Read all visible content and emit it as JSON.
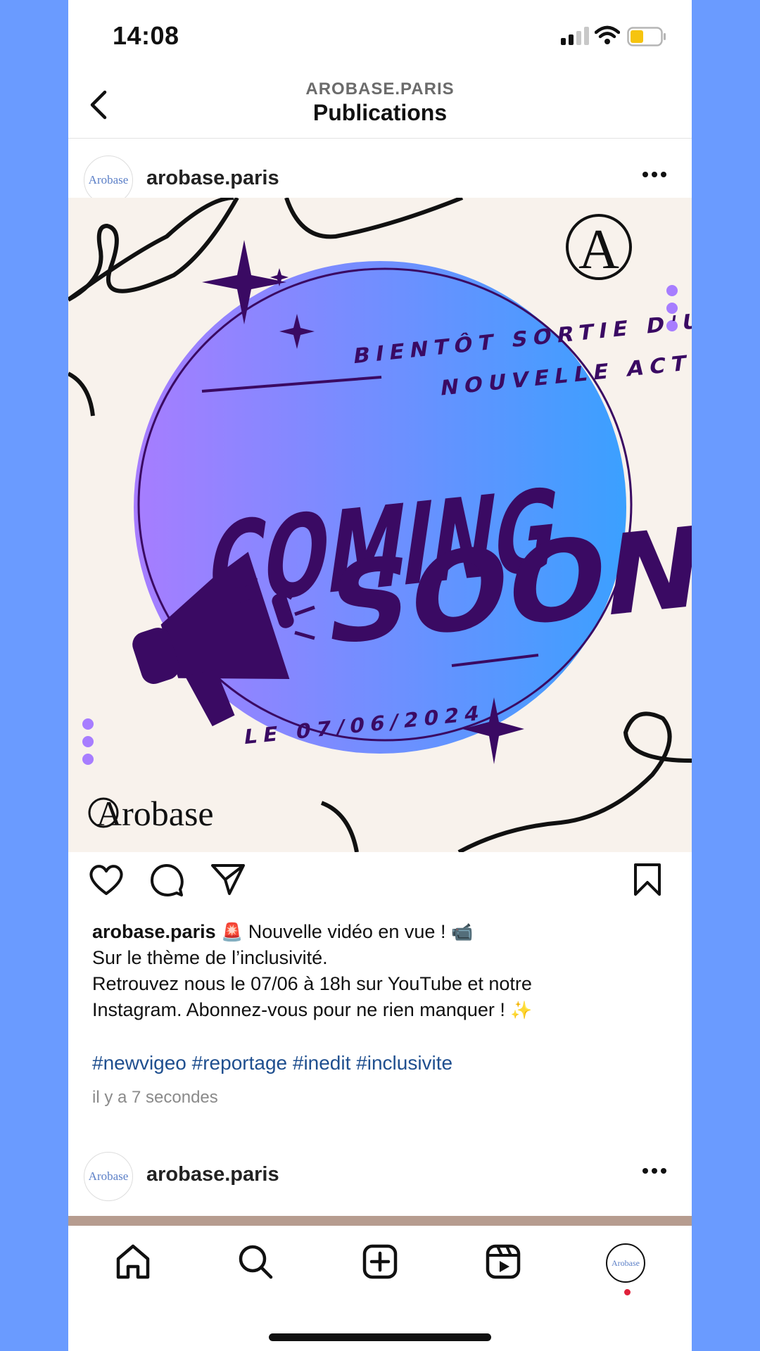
{
  "status": {
    "time": "14:08"
  },
  "header": {
    "account": "AROBASE.PARIS",
    "title": "Publications"
  },
  "post": {
    "username": "arobase.paris",
    "avatar_text": "Arobase",
    "image": {
      "headline_top": "BIENTÔT SORTIE D'UNE",
      "headline_bottom": "NOUVELLE ACTU.",
      "big_line1": "COMING",
      "big_line2": "SOON",
      "date": "LE 07/06/2024",
      "brand": "Arobase",
      "brand_letter": "A"
    },
    "caption": {
      "username": "arobase.paris",
      "emoji_siren": "🚨",
      "line1": "Nouvelle vidéo en vue !",
      "emoji_camera": "📹",
      "line2": "Sur le thème de l’inclusivité.",
      "line3": "Retrouvez nous le 07/06 à 18h sur YouTube et notre",
      "line4": "Instagram. Abonnez-vous pour ne rien manquer !",
      "emoji_sparkles": "✨"
    },
    "hashtags": "#newvigeo #reportage #inedit #inclusivite",
    "time_ago": "il y a 7 secondes"
  },
  "next_post": {
    "username": "arobase.paris",
    "avatar_text": "Arobase"
  },
  "colors": {
    "accent_purple": "#3a0a63",
    "gradient_start": "#a77dff",
    "gradient_end": "#3ba0ff",
    "hashtag": "#1f4f8f"
  }
}
